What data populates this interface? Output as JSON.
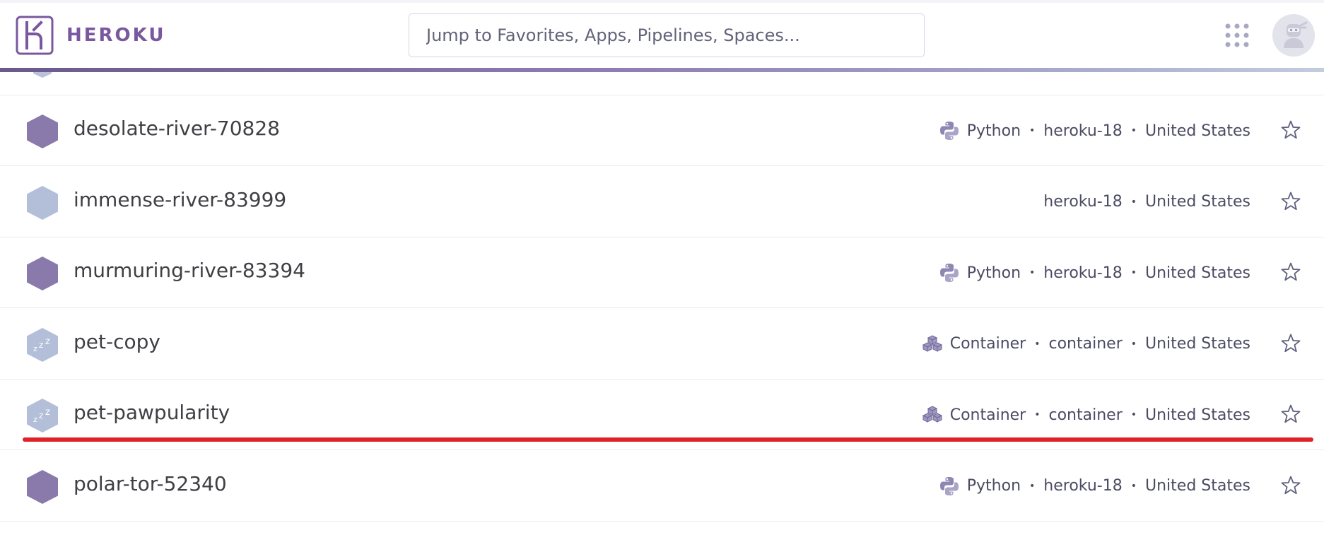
{
  "header": {
    "brand": "HEROKU",
    "search_placeholder": "Jump to Favorites, Apps, Pipelines, Spaces..."
  },
  "apps": [
    {
      "name": "desolate-river-70828",
      "status": "active",
      "language": "Python",
      "language_icon": "python-icon",
      "stack": "heroku-18",
      "region": "United States"
    },
    {
      "name": "immense-river-83999",
      "status": "inactive",
      "language": "",
      "language_icon": "",
      "stack": "heroku-18",
      "region": "United States"
    },
    {
      "name": "murmuring-river-83394",
      "status": "active",
      "language": "Python",
      "language_icon": "python-icon",
      "stack": "heroku-18",
      "region": "United States"
    },
    {
      "name": "pet-copy",
      "status": "sleeping",
      "language": "Container",
      "language_icon": "container-icon",
      "stack": "container",
      "region": "United States"
    },
    {
      "name": "pet-pawpularity",
      "status": "sleeping",
      "language": "Container",
      "language_icon": "container-icon",
      "stack": "container",
      "region": "United States"
    },
    {
      "name": "polar-tor-52340",
      "status": "active",
      "language": "Python",
      "language_icon": "python-icon",
      "stack": "heroku-18",
      "region": "United States"
    }
  ],
  "colors": {
    "brand": "#79589f",
    "hex_active": "#8a7aab",
    "hex_inactive": "#b3bed8",
    "highlight": "#e02127"
  }
}
